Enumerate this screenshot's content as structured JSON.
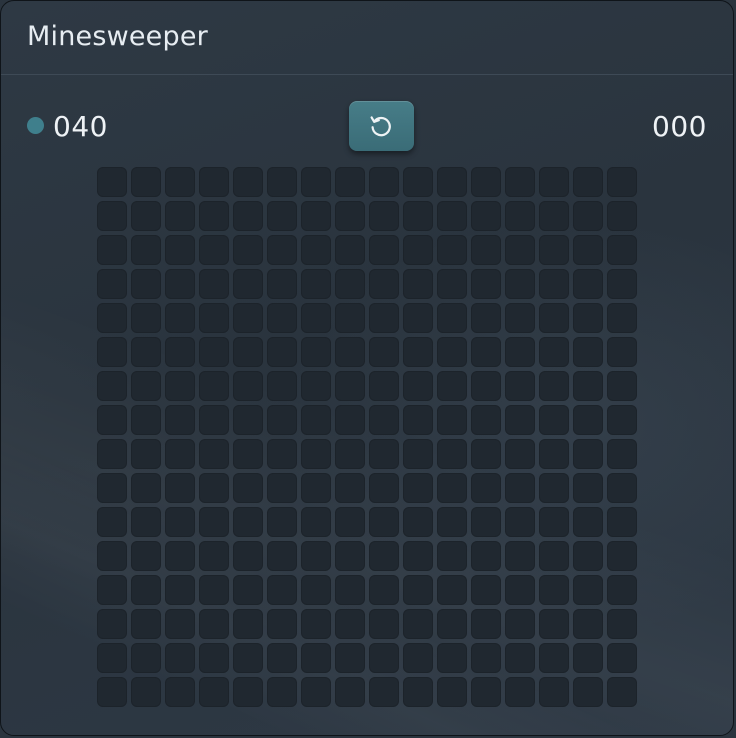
{
  "window": {
    "title": "Minesweeper"
  },
  "status": {
    "mines_remaining": "040",
    "timer": "000",
    "mine_indicator_color": "#3f7f8c"
  },
  "controls": {
    "reset_icon": "restart-icon"
  },
  "board": {
    "rows": 16,
    "columns": 16,
    "state": "all-unrevealed",
    "cell_color": "#202830"
  },
  "colors": {
    "background": "#2a343e",
    "accent": "#477d88",
    "text": "#e7edf2"
  }
}
